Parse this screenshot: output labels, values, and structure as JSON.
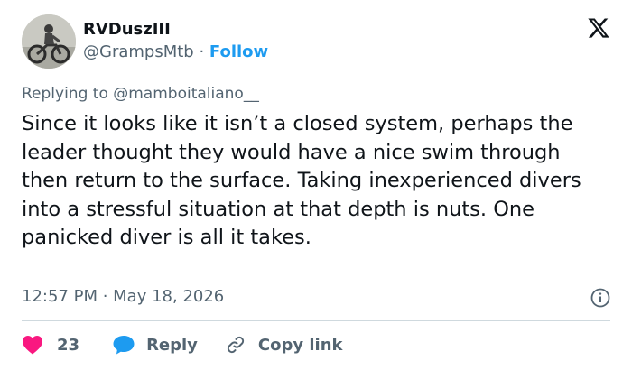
{
  "author": {
    "display_name": "RVDuszIII",
    "handle": "@GrampsMtb",
    "separator": " · ",
    "follow_label": "Follow",
    "avatar_icon": "motorcycle-rider-avatar"
  },
  "brand": {
    "logo_icon": "x-logo"
  },
  "reply_context": {
    "prefix": "Replying to ",
    "mention": "@mamboitaliano__"
  },
  "tweet": {
    "text": "Since it looks like it isn’t a closed system, perhaps the leader thought they would have a nice swim through then return to the surface. Taking inexperienced divers into a stressful situation at that depth is nuts. One panicked diver is all it takes."
  },
  "meta": {
    "time": "12:57 PM",
    "separator": " · ",
    "date": "May 18, 2026",
    "info_icon": "info-icon"
  },
  "actions": {
    "like_count": "23",
    "reply_label": "Reply",
    "copy_link_label": "Copy link"
  },
  "colors": {
    "text": "#0f1419",
    "secondary": "#536471",
    "link": "#1d9bf0",
    "heart": "#f91880",
    "divider": "#cfd9de"
  }
}
